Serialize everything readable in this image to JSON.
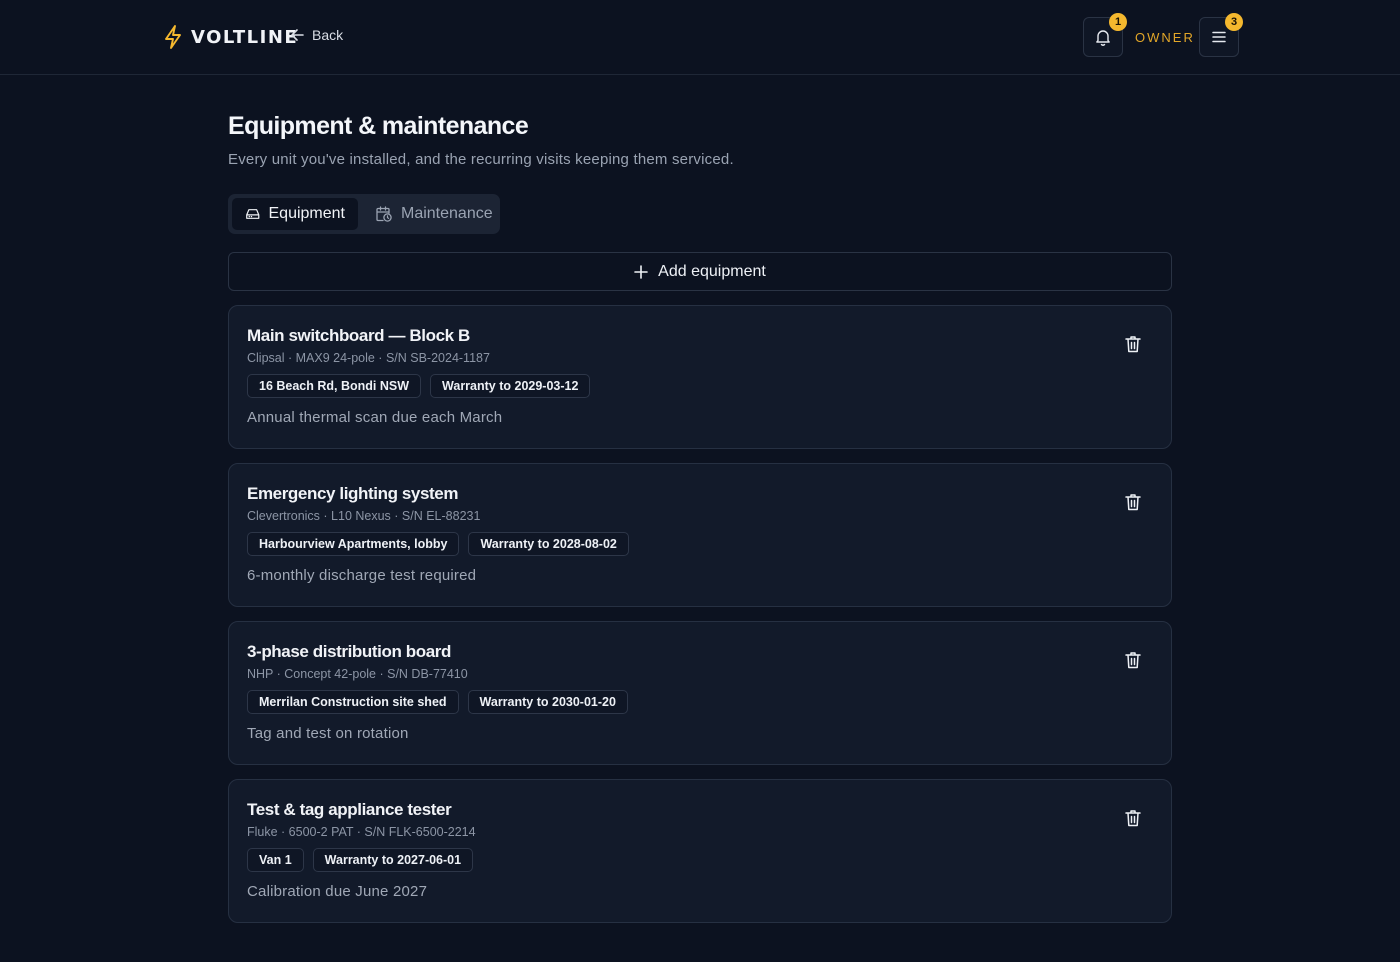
{
  "header": {
    "brand": "VOLTLINE",
    "back_label": "Back",
    "notifications_count": "1",
    "role": "OWNER",
    "menu_count": "3"
  },
  "page": {
    "title": "Equipment & maintenance",
    "subtitle": "Every unit you've installed, and the recurring visits keeping them serviced."
  },
  "tabs": [
    {
      "label": "Equipment",
      "icon": "hard-drive-icon",
      "active": true
    },
    {
      "label": "Maintenance",
      "icon": "calendar-clock-icon",
      "active": false
    }
  ],
  "add_button": {
    "label": "Add equipment"
  },
  "equipment": [
    {
      "title": "Main switchboard — Block B",
      "meta": "Clipsal · MAX9 24-pole · S/N SB-2024-1187",
      "location": "16 Beach Rd, Bondi NSW",
      "warranty": "Warranty to 2029-03-12",
      "note": "Annual thermal scan due each March"
    },
    {
      "title": "Emergency lighting system",
      "meta": "Clevertronics · L10 Nexus · S/N EL-88231",
      "location": "Harbourview Apartments, lobby",
      "warranty": "Warranty to 2028-08-02",
      "note": "6-monthly discharge test required"
    },
    {
      "title": "3-phase distribution board",
      "meta": "NHP · Concept 42-pole · S/N DB-77410",
      "location": "Merrilan Construction site shed",
      "warranty": "Warranty to 2030-01-20",
      "note": "Tag and test on rotation"
    },
    {
      "title": "Test & tag appliance tester",
      "meta": "Fluke · 6500-2 PAT · S/N FLK-6500-2214",
      "location": "Van 1",
      "warranty": "Warranty to 2027-06-01",
      "note": "Calibration due June 2027"
    }
  ],
  "colors": {
    "background": "#0c1220",
    "card": "#121a2a",
    "accent": "#f5b82e",
    "role": "#e2a628"
  }
}
